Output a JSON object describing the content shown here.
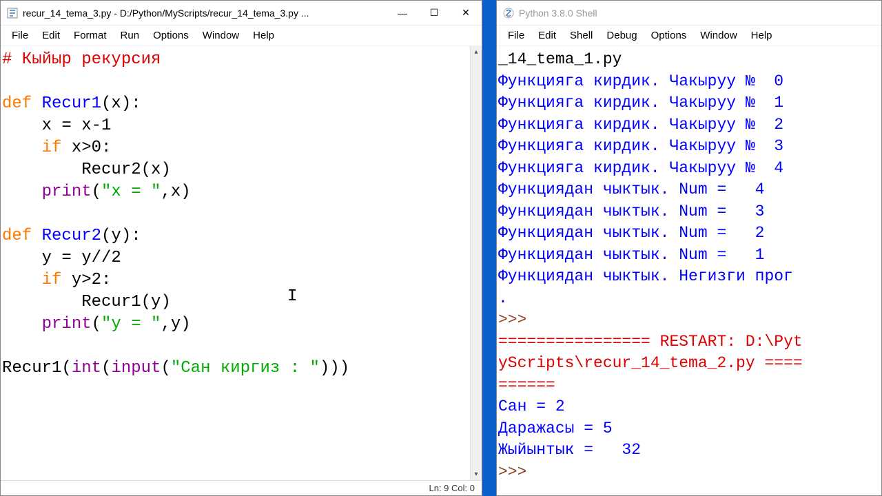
{
  "left": {
    "title_prefix": "recur_14_tema_3.py",
    "title": "recur_14_tema_3.py - D:/Python/MyScripts/recur_14_tema_3.py ...",
    "menu": [
      "File",
      "Edit",
      "Format",
      "Run",
      "Options",
      "Window",
      "Help"
    ],
    "status": "Ln: 9  Col: 0",
    "code": {
      "l1_comment": "# Кыйыр рекурсия",
      "l3_def": "def ",
      "l3_name": "Recur1",
      "l3_rest": "(x):",
      "l4": "    x = x-1",
      "l5_if": "    if ",
      "l5_rest": "x>0:",
      "l6": "        Recur2(x)",
      "l7_ind": "    ",
      "l7_print": "print",
      "l7_paren": "(",
      "l7_str": "\"x = \"",
      "l7_end": ",x)",
      "l9_def": "def ",
      "l9_name": "Recur2",
      "l9_rest": "(y):",
      "l10": "    y = y//2",
      "l11_if": "    if ",
      "l11_rest": "y>2:",
      "l12": "        Recur1(y)",
      "l13_ind": "    ",
      "l13_print": "print",
      "l13_paren": "(",
      "l13_str": "\"y = \"",
      "l13_end": ",y)",
      "l15_name": "Recur1(",
      "l15_int": "int",
      "l15_p1": "(",
      "l15_input": "input",
      "l15_p2": "(",
      "l15_str": "\"Сан киргиз : \"",
      "l15_end": ")))"
    }
  },
  "right": {
    "title": "Python 3.8.0 Shell",
    "menu": [
      "File",
      "Edit",
      "Shell",
      "Debug",
      "Options",
      "Window",
      "Help"
    ],
    "out": {
      "l1": "_14_tema_1.py",
      "enter": "Функцияга кирдик. Чакыруу №  ",
      "n0": "0",
      "n1": "1",
      "n2": "2",
      "n3": "3",
      "n4": "4",
      "exit": "Функциядан чыктык. Num =   ",
      "exit_last": "Функциядан чыктык. Негизги прог",
      "dot": ".",
      "prompt": ">>> ",
      "restart1": "================ RESTART: D:\\Pyt",
      "restart2": "yScripts\\recur_14_tema_2.py ====",
      "restart3": "======",
      "san": "Сан = 2",
      "dar": "Даражасы = 5",
      "jiy": "Жыйынтык =   32"
    }
  },
  "glyphs": {
    "min": "—",
    "max": "☐",
    "close": "✕",
    "up": "▴",
    "down": "▾"
  }
}
